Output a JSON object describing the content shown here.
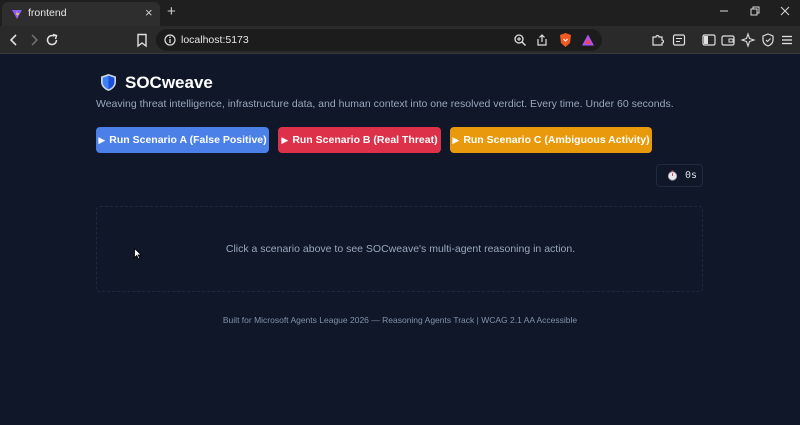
{
  "browser": {
    "tab_title": "frontend",
    "tab_close_icon": "×",
    "new_tab_icon": "+",
    "url": "localhost:5173",
    "window_controls": [
      "minimize-icon",
      "restore-icon",
      "close-icon"
    ]
  },
  "app": {
    "logo_icon": "shield-icon",
    "title": "SOCweave",
    "tagline": "Weaving threat intelligence, infrastructure data, and human context into one resolved verdict. Every time. Under 60 seconds."
  },
  "scenarios": [
    {
      "label": "Run Scenario A (False Positive)",
      "color": "#4a80e8"
    },
    {
      "label": "Run Scenario B (Real Threat)",
      "color": "#dc3148"
    },
    {
      "label": "Run Scenario C (Ambiguous Activity)",
      "color": "#e89a0c"
    }
  ],
  "play_glyph": "▶",
  "timer": {
    "icon": "stopwatch-icon",
    "value": "0s"
  },
  "empty_state": "Click a scenario above to see SOCweave's multi-agent reasoning in action.",
  "footer": "Built for Microsoft Agents League 2026 — Reasoning Agents Track | WCAG 2.1 AA Accessible"
}
